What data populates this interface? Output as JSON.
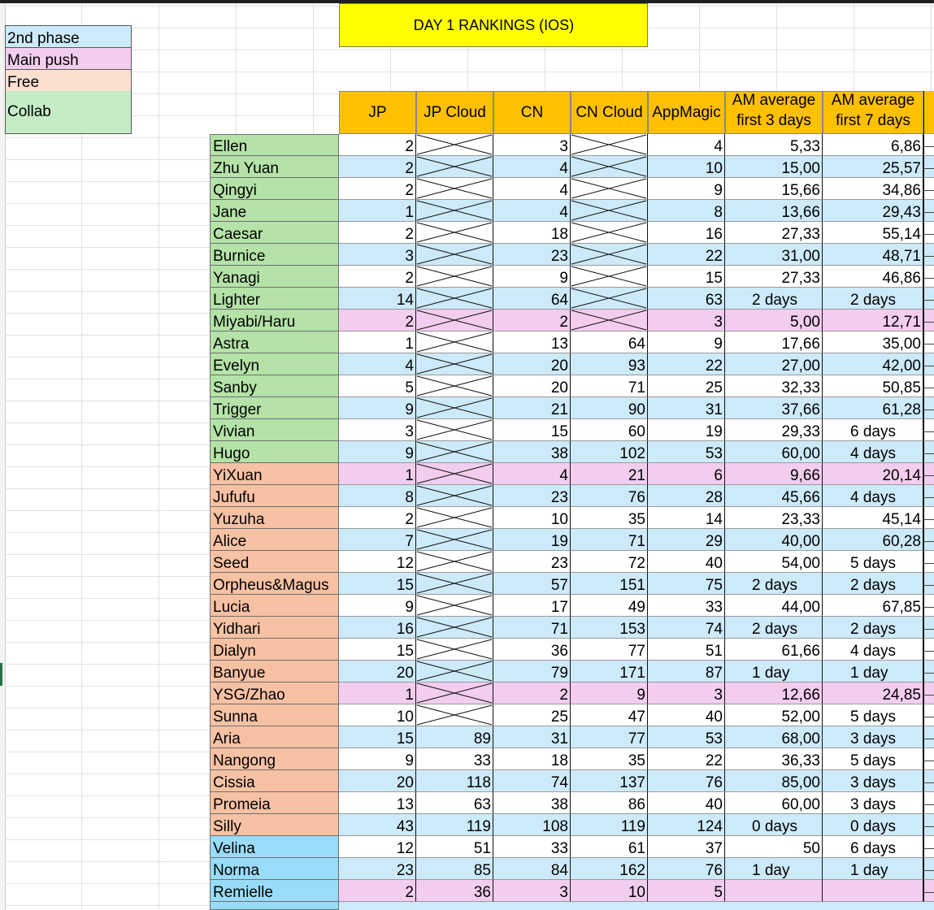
{
  "sheet": {
    "title": "DAY 1 RANKINGS (IOS)",
    "legend": [
      {
        "label": "2nd phase",
        "color": "#cdeafa"
      },
      {
        "label": "Main push",
        "color": "#f3cdee"
      },
      {
        "label": "Free",
        "color": "#fbe0d1"
      },
      {
        "label": "Collab",
        "color": "#c4ecc6"
      }
    ],
    "columns": [
      "JP",
      "JP Cloud",
      "CN",
      "CN Cloud",
      "AppMagic",
      "AM average first 3 days",
      "AM average first 7 days"
    ],
    "colors": {
      "header": "#ffc000",
      "title": "#ffff00",
      "name_standard": "#b4e2a7",
      "name_free": "#f7c1a4",
      "name_other": "#99dcf7",
      "row_blue": "#cdeafa",
      "row_pink": "#f3cdee",
      "row_white": "#ffffff"
    },
    "rows": [
      {
        "name": "Ellen",
        "group": "standard",
        "band": "white",
        "jp": "2",
        "jp_cloud": null,
        "cn": "3",
        "cn_cloud": null,
        "appmagic": "4",
        "am3": "5,33",
        "am7": "6,86"
      },
      {
        "name": "Zhu Yuan",
        "group": "standard",
        "band": "blue",
        "jp": "2",
        "jp_cloud": null,
        "cn": "4",
        "cn_cloud": null,
        "appmagic": "10",
        "am3": "15,00",
        "am7": "25,57"
      },
      {
        "name": "Qingyi",
        "group": "standard",
        "band": "white",
        "jp": "2",
        "jp_cloud": null,
        "cn": "4",
        "cn_cloud": null,
        "appmagic": "9",
        "am3": "15,66",
        "am7": "34,86"
      },
      {
        "name": "Jane",
        "group": "standard",
        "band": "blue",
        "jp": "1",
        "jp_cloud": null,
        "cn": "4",
        "cn_cloud": null,
        "appmagic": "8",
        "am3": "13,66",
        "am7": "29,43"
      },
      {
        "name": "Caesar",
        "group": "standard",
        "band": "white",
        "jp": "2",
        "jp_cloud": null,
        "cn": "18",
        "cn_cloud": null,
        "appmagic": "16",
        "am3": "27,33",
        "am7": "55,14"
      },
      {
        "name": "Burnice",
        "group": "standard",
        "band": "blue",
        "jp": "3",
        "jp_cloud": null,
        "cn": "23",
        "cn_cloud": null,
        "appmagic": "22",
        "am3": "31,00",
        "am7": "48,71"
      },
      {
        "name": "Yanagi",
        "group": "standard",
        "band": "white",
        "jp": "2",
        "jp_cloud": null,
        "cn": "9",
        "cn_cloud": null,
        "appmagic": "15",
        "am3": "27,33",
        "am7": "46,86"
      },
      {
        "name": "Lighter",
        "group": "standard",
        "band": "blue",
        "jp": "14",
        "jp_cloud": null,
        "cn": "64",
        "cn_cloud": null,
        "appmagic": "63",
        "am3": "2 days",
        "am7": "2 days"
      },
      {
        "name": "Miyabi/Haru",
        "group": "standard",
        "band": "pink",
        "jp": "2",
        "jp_cloud": null,
        "cn": "2",
        "cn_cloud": null,
        "appmagic": "3",
        "am3": "5,00",
        "am7": "12,71"
      },
      {
        "name": "Astra",
        "group": "standard",
        "band": "white",
        "jp": "1",
        "jp_cloud": null,
        "cn": "13",
        "cn_cloud": "64",
        "appmagic": "9",
        "am3": "17,66",
        "am7": "35,00"
      },
      {
        "name": "Evelyn",
        "group": "standard",
        "band": "blue",
        "jp": "4",
        "jp_cloud": null,
        "cn": "20",
        "cn_cloud": "93",
        "appmagic": "22",
        "am3": "27,00",
        "am7": "42,00"
      },
      {
        "name": "Sanby",
        "group": "standard",
        "band": "white",
        "jp": "5",
        "jp_cloud": null,
        "cn": "20",
        "cn_cloud": "71",
        "appmagic": "25",
        "am3": "32,33",
        "am7": "50,85"
      },
      {
        "name": "Trigger",
        "group": "standard",
        "band": "blue",
        "jp": "9",
        "jp_cloud": null,
        "cn": "21",
        "cn_cloud": "90",
        "appmagic": "31",
        "am3": "37,66",
        "am7": "61,28"
      },
      {
        "name": "Vivian",
        "group": "standard",
        "band": "white",
        "jp": "3",
        "jp_cloud": null,
        "cn": "15",
        "cn_cloud": "60",
        "appmagic": "19",
        "am3": "29,33",
        "am7": "6 days"
      },
      {
        "name": "Hugo",
        "group": "standard",
        "band": "blue",
        "jp": "9",
        "jp_cloud": null,
        "cn": "38",
        "cn_cloud": "102",
        "appmagic": "53",
        "am3": "60,00",
        "am7": "4 days"
      },
      {
        "name": "YiXuan",
        "group": "free",
        "band": "pink",
        "jp": "1",
        "jp_cloud": null,
        "cn": "4",
        "cn_cloud": "21",
        "appmagic": "6",
        "am3": "9,66",
        "am7": "20,14"
      },
      {
        "name": "Jufufu",
        "group": "free",
        "band": "blue",
        "jp": "8",
        "jp_cloud": null,
        "cn": "23",
        "cn_cloud": "76",
        "appmagic": "28",
        "am3": "45,66",
        "am7": "4 days"
      },
      {
        "name": "Yuzuha",
        "group": "free",
        "band": "white",
        "jp": "2",
        "jp_cloud": null,
        "cn": "10",
        "cn_cloud": "35",
        "appmagic": "14",
        "am3": "23,33",
        "am7": "45,14"
      },
      {
        "name": "Alice",
        "group": "free",
        "band": "blue",
        "jp": "7",
        "jp_cloud": null,
        "cn": "19",
        "cn_cloud": "71",
        "appmagic": "29",
        "am3": "40,00",
        "am7": "60,28"
      },
      {
        "name": "Seed",
        "group": "free",
        "band": "white",
        "jp": "12",
        "jp_cloud": null,
        "cn": "23",
        "cn_cloud": "72",
        "appmagic": "40",
        "am3": "54,00",
        "am7": "5 days"
      },
      {
        "name": "Orpheus&Magus",
        "group": "free",
        "band": "blue",
        "jp": "15",
        "jp_cloud": null,
        "cn": "57",
        "cn_cloud": "151",
        "appmagic": "75",
        "am3": "2 days",
        "am7": "2 days"
      },
      {
        "name": "Lucia",
        "group": "free",
        "band": "white",
        "jp": "9",
        "jp_cloud": null,
        "cn": "17",
        "cn_cloud": "49",
        "appmagic": "33",
        "am3": "44,00",
        "am7": "67,85"
      },
      {
        "name": "Yidhari",
        "group": "free",
        "band": "blue",
        "jp": "16",
        "jp_cloud": null,
        "cn": "71",
        "cn_cloud": "153",
        "appmagic": "74",
        "am3": "2 days",
        "am7": "2 days"
      },
      {
        "name": "Dialyn",
        "group": "free",
        "band": "white",
        "jp": "15",
        "jp_cloud": null,
        "cn": "36",
        "cn_cloud": "77",
        "appmagic": "51",
        "am3": "61,66",
        "am7": "4 days"
      },
      {
        "name": "Banyue",
        "group": "free",
        "band": "blue",
        "jp": "20",
        "jp_cloud": null,
        "cn": "79",
        "cn_cloud": "171",
        "appmagic": "87",
        "am3": "1 day",
        "am7": "1 day"
      },
      {
        "name": "YSG/Zhao",
        "group": "free",
        "band": "pink",
        "jp": "1",
        "jp_cloud": null,
        "cn": "2",
        "cn_cloud": "9",
        "appmagic": "3",
        "am3": "12,66",
        "am7": "24,85"
      },
      {
        "name": "Sunna",
        "group": "free",
        "band": "white",
        "jp": "10",
        "jp_cloud": null,
        "cn": "25",
        "cn_cloud": "47",
        "appmagic": "40",
        "am3": "52,00",
        "am7": "5 days"
      },
      {
        "name": "Aria",
        "group": "free",
        "band": "blue",
        "jp": "15",
        "jp_cloud": "89",
        "cn": "31",
        "cn_cloud": "77",
        "appmagic": "53",
        "am3": "68,00",
        "am7": "3 days"
      },
      {
        "name": "Nangong",
        "group": "free",
        "band": "white",
        "jp": "9",
        "jp_cloud": "33",
        "cn": "18",
        "cn_cloud": "35",
        "appmagic": "22",
        "am3": "36,33",
        "am7": "5 days"
      },
      {
        "name": "Cissia",
        "group": "free",
        "band": "blue",
        "jp": "20",
        "jp_cloud": "118",
        "cn": "74",
        "cn_cloud": "137",
        "appmagic": "76",
        "am3": "85,00",
        "am7": "3 days"
      },
      {
        "name": "Promeia",
        "group": "free",
        "band": "white",
        "jp": "13",
        "jp_cloud": "63",
        "cn": "38",
        "cn_cloud": "86",
        "appmagic": "40",
        "am3": "60,00",
        "am7": "3 days"
      },
      {
        "name": "Silly",
        "group": "free",
        "band": "blue",
        "jp": "43",
        "jp_cloud": "119",
        "cn": "108",
        "cn_cloud": "119",
        "appmagic": "124",
        "am3": "0 days",
        "am7": "0 days"
      },
      {
        "name": "Velina",
        "group": "other",
        "band": "white",
        "jp": "12",
        "jp_cloud": "51",
        "cn": "33",
        "cn_cloud": "61",
        "appmagic": "37",
        "am3": "50",
        "am7": "6 days"
      },
      {
        "name": "Norma",
        "group": "other",
        "band": "blue",
        "jp": "23",
        "jp_cloud": "85",
        "cn": "84",
        "cn_cloud": "162",
        "appmagic": "76",
        "am3": "1 day",
        "am7": "1 day"
      },
      {
        "name": "Remielle",
        "group": "other",
        "band": "pink",
        "jp": "2",
        "jp_cloud": "36",
        "cn": "3",
        "cn_cloud": "10",
        "appmagic": "5",
        "am3": "",
        "am7": ""
      }
    ]
  }
}
